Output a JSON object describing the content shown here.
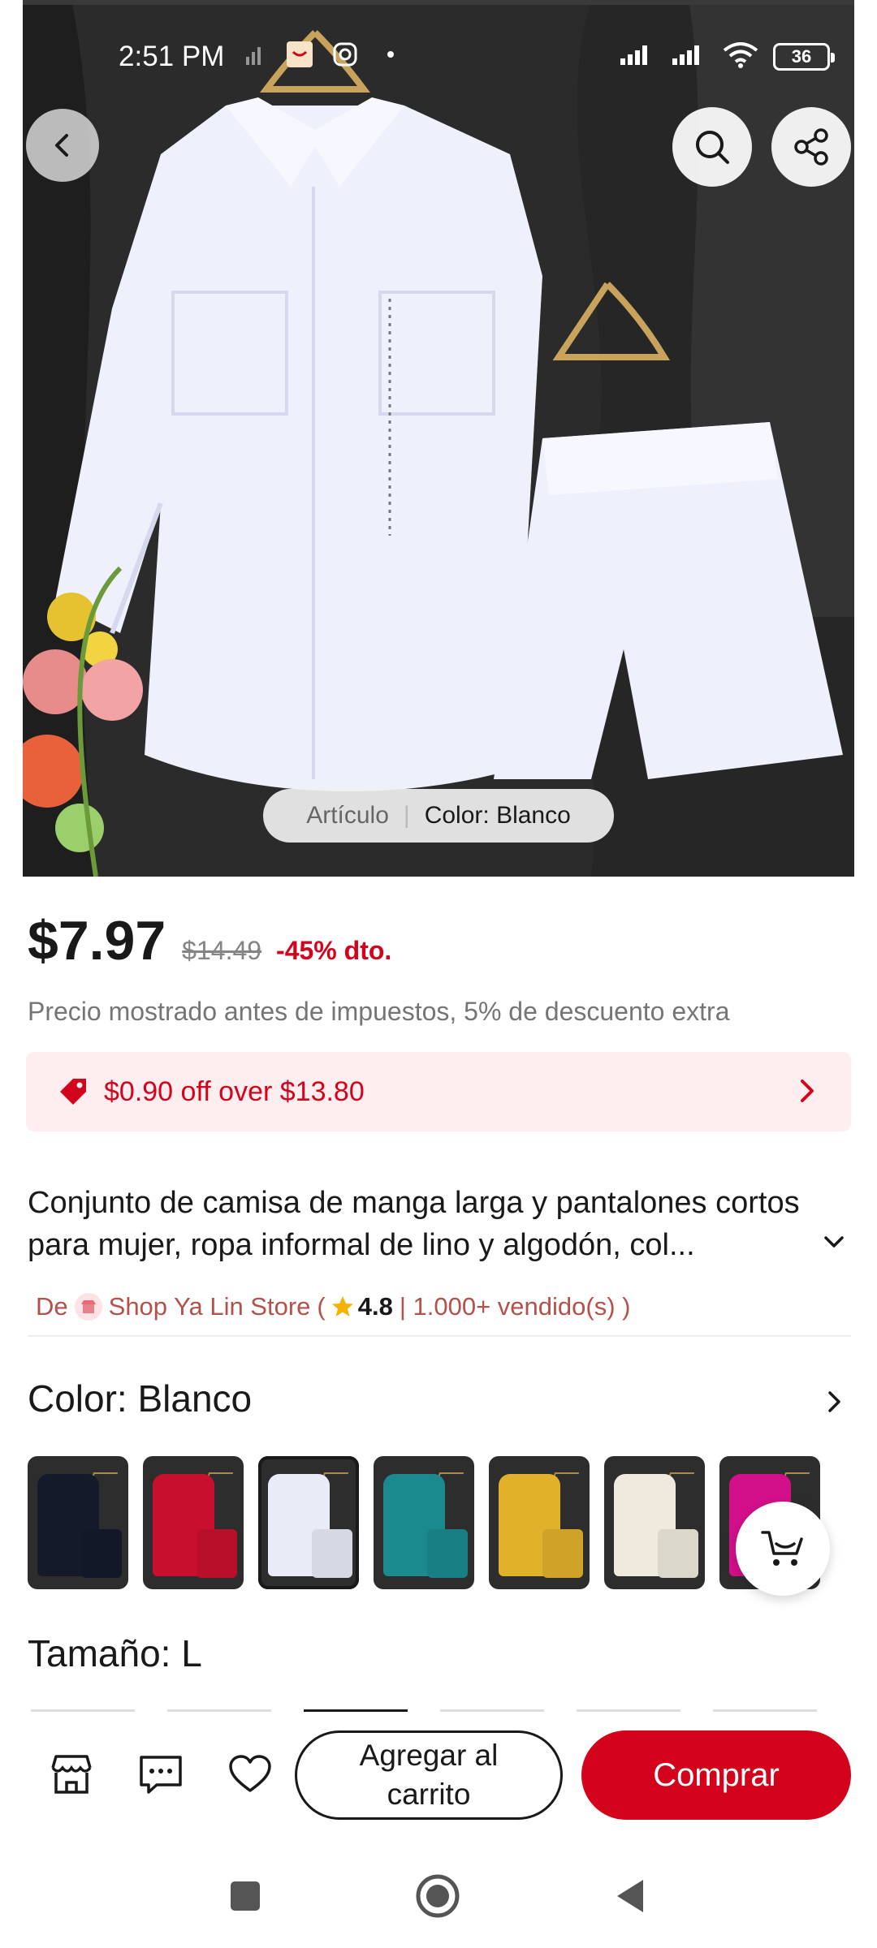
{
  "status_bar": {
    "time": "2:51 PM",
    "battery": "36"
  },
  "hero": {
    "pill_item_label": "Artículo",
    "pill_separator": "|",
    "pill_color_label": "Color: Blanco",
    "icons": [
      "chevron-left-icon",
      "search-icon",
      "share-icon"
    ]
  },
  "price": {
    "current": "$7.97",
    "original": "$14.49",
    "discount": "-45% dto.",
    "tax_note": "Precio mostrado antes de impuestos, 5% de descuento extra"
  },
  "coupon": {
    "text": "$0.90 off over $13.80"
  },
  "product": {
    "title": "Conjunto de camisa de manga larga y pantalones cortos para mujer, ropa informal de lino y algodón, col..."
  },
  "store": {
    "prefix": "De",
    "name": "Shop Ya Lin Store",
    "open_paren": "(",
    "rating": "4.8",
    "sold": "| 1.000+ vendido(s) )"
  },
  "color": {
    "title": "Color: Blanco",
    "swatches": [
      {
        "name": "negro",
        "color": "#141a2a",
        "selected": false
      },
      {
        "name": "rojo",
        "color": "#c8102e",
        "selected": false
      },
      {
        "name": "blanco",
        "color": "#e9ecf7",
        "selected": true
      },
      {
        "name": "verde azulado",
        "color": "#1a8a8f",
        "selected": false
      },
      {
        "name": "amarillo",
        "color": "#e1b12a",
        "selected": false
      },
      {
        "name": "beige",
        "color": "#efeadd",
        "selected": false
      },
      {
        "name": "fucsia",
        "color": "#d3108a",
        "selected": false
      }
    ]
  },
  "size": {
    "title": "Tamaño: L"
  },
  "actions": {
    "add_to_cart": "Agregar al carrito",
    "buy": "Comprar"
  },
  "colors": {
    "accent": "#d3031c",
    "coupon_bg": "#ffeef0",
    "text": "#191919",
    "muted": "#757575"
  }
}
